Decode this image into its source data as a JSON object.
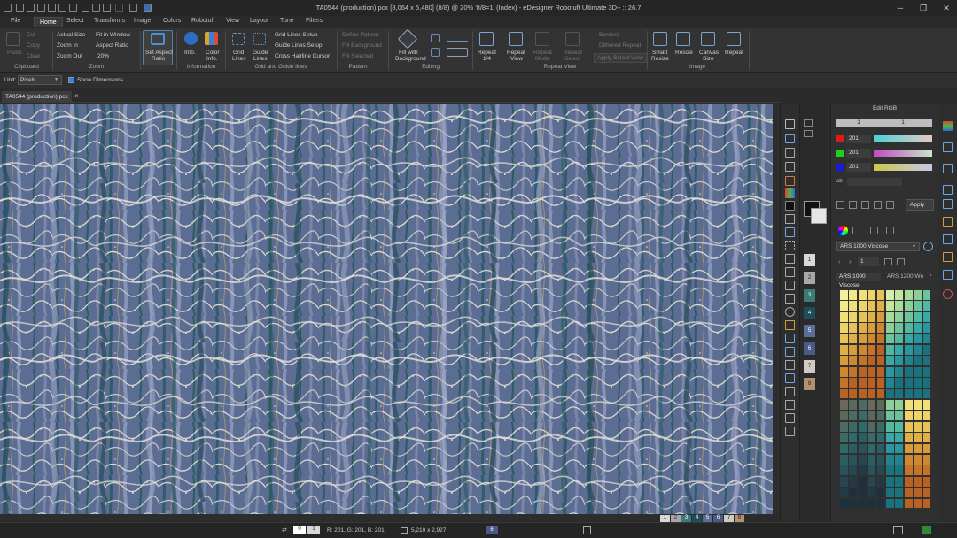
{
  "window": {
    "title": "TA0544 (production).pcx [8,064 x 5,480] (8/8) @ 20% '8/8=1' (Index) - eDesigner Robotuft Ultimate 3D+ :: 26.7",
    "controls": [
      "─",
      "❐",
      "✕"
    ]
  },
  "menu_tabs": [
    "File",
    "Home",
    "Select",
    "Transforms",
    "Image",
    "Colors",
    "Robotuft",
    "View",
    "Layout",
    "Tune",
    "Filters"
  ],
  "ribbon": {
    "clipboard": {
      "paste": "Paste",
      "cut": "Cut",
      "copy": "Copy",
      "clear": "Clear",
      "group": "Clipboard"
    },
    "zoom": {
      "actual_size": "Actual Size",
      "fit_in_window": "Fit in Window",
      "zoom_in": "Zoom In",
      "aspect_ratio": "Aspect Ratio",
      "zoom_out": "Zoom Out",
      "zoom_value": "20%",
      "group": "Zoom"
    },
    "set_aspect": {
      "line1": "Set Aspect",
      "line2": "Ratio"
    },
    "information": {
      "info": "Info.",
      "color_info_1": "Color",
      "color_info_2": "Info.",
      "group": "Information"
    },
    "grid": {
      "grid_lines_1": "Grid",
      "grid_lines_2": "Lines",
      "guide_lines_1": "Guide",
      "guide_lines_2": "Lines",
      "grid_setup": "Grid Lines Setup",
      "guide_setup": "Guide Lines Setup",
      "cross_hair": "Cross Hairline Cursor",
      "group": "Grid and Guide lines"
    },
    "pattern": {
      "define": "Define Pattern",
      "fill_bg": "Fill Background",
      "fill_sel": "Fill Selected",
      "group": "Pattern"
    },
    "editing": {
      "fill_bg_1": "Fill with",
      "fill_bg_2": "Background",
      "group": "Editing"
    },
    "repeat_view": {
      "repeat_quarter_1": "Repeat",
      "repeat_quarter_2": "1/4",
      "repeat_view_1": "Repeat",
      "repeat_view_2": "View",
      "repeat_mode_1": "Repeat",
      "repeat_mode_2": "Mode",
      "repeat_select_1": "Repeat",
      "repeat_select_2": "Select",
      "borders": "Borders",
      "dithered": "Dithered Repeat",
      "apply_select": "Apply Select View",
      "group": "Repeat View"
    },
    "image": {
      "smart_resize_1": "Smart",
      "smart_resize_2": "Resize",
      "resize": "Resize",
      "canvas_size_1": "Canvas",
      "canvas_size_2": "Size",
      "repeat": "Repeat",
      "group": "Image"
    }
  },
  "options_bar": {
    "unit_label": "Unit:",
    "unit_value": "Pixels",
    "show_dimensions": "Show Dimensions"
  },
  "document_tab": {
    "name": "TA0544 (production).pcx",
    "close": "×"
  },
  "edit_rgb": {
    "title": "Edit RGB",
    "index_left": "1",
    "index_right": "1",
    "r": "201",
    "g": "201",
    "b": "201",
    "ab_label": "ab",
    "apply": "Apply",
    "colorbook": "ARS 1000 Viscose",
    "page_value": "1",
    "tabs": [
      "ARS 1000 Viscose",
      "ARS 1200 Wo"
    ]
  },
  "palette_indices": [
    "1",
    "2",
    "3",
    "4",
    "5",
    "6",
    "7",
    "8"
  ],
  "status": {
    "rgb": "R: 201, G: 201, B: 201",
    "size": "5,210 x 2,927",
    "index": "6",
    "left_a": "0",
    "left_b": "1"
  },
  "bottom_indices": [
    "1",
    "2",
    "3",
    "4",
    "5",
    "6",
    "7",
    "8"
  ],
  "colors": {
    "accent": "#3b7fd6",
    "canvas_base": "#5a6f96"
  }
}
